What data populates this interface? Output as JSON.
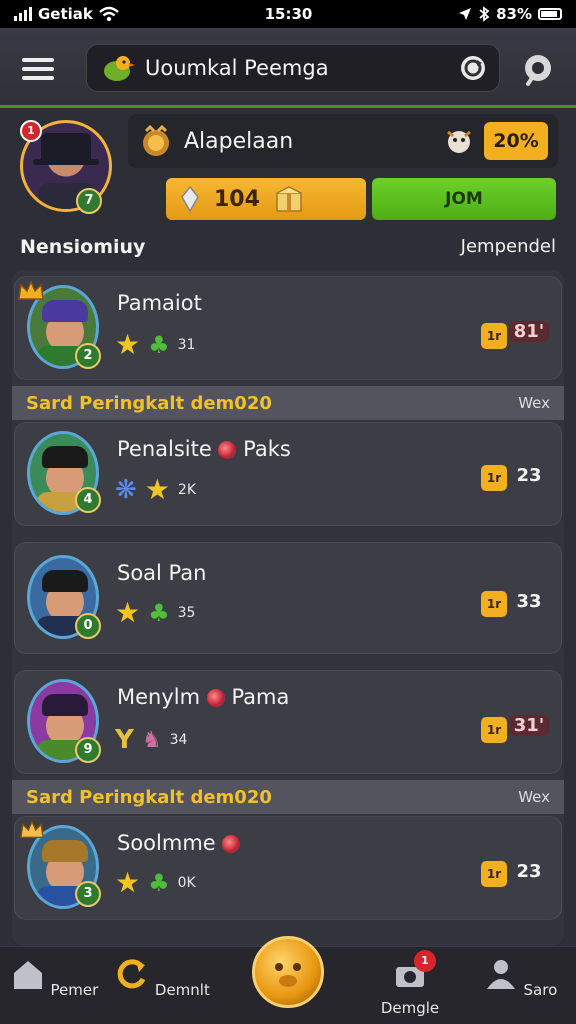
{
  "status_bar": {
    "carrier": "Getiak",
    "time": "15:30",
    "battery": "83%"
  },
  "header": {
    "title": "Uoumkal Peemga"
  },
  "profile": {
    "name": "Alapelaan",
    "badge": "1",
    "level": "7",
    "percent": "20%",
    "coins": "104",
    "action": "JOM",
    "left_label": "Nensiomiuy",
    "right_label": "Jempendel"
  },
  "sections": [
    {
      "title": "Sard Peringkalt dem020",
      "right": "Wex"
    },
    {
      "title": "Sard Peringkalt dem020",
      "right": "Wex"
    }
  ],
  "players": [
    {
      "name": "Pamaiot",
      "extra": "",
      "level": "2",
      "stat": "31",
      "rank_badge": "1r",
      "rank": "81'",
      "highlight": true
    },
    {
      "name": "Penalsite",
      "extra": "Paks",
      "level": "4",
      "stat": "2K",
      "rank_badge": "1r",
      "rank": "23",
      "highlight": false
    },
    {
      "name": "Soal Pan",
      "extra": "",
      "level": "0",
      "stat": "35",
      "rank_badge": "1r",
      "rank": "33",
      "highlight": false
    },
    {
      "name": "Menylm",
      "extra": "Pama",
      "level": "9",
      "stat": "34",
      "rank_badge": "1r",
      "rank": "31'",
      "highlight": true
    },
    {
      "name": "Soolmme",
      "extra": "",
      "level": "3",
      "stat": "0K",
      "rank_badge": "1r",
      "rank": "23",
      "highlight": false
    }
  ],
  "nav": {
    "items": [
      "Pemer",
      "Demnlt",
      "Demgle",
      "Saro"
    ],
    "badge": "1"
  }
}
